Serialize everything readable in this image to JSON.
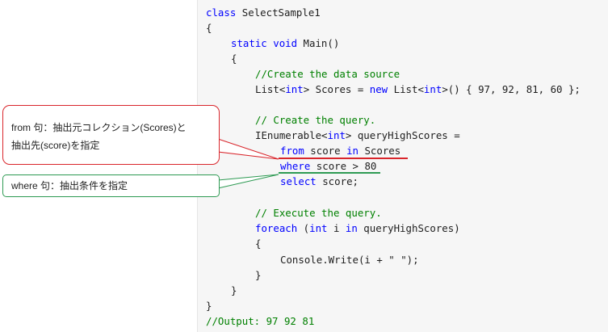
{
  "code": {
    "l01_class": "class",
    "l01_name": " SelectSample1",
    "l02": "{",
    "l03_static": "static",
    "l03_void": "void",
    "l03_main": " Main()",
    "l04": "{",
    "l05_comment": "//Create the data source",
    "l06_list": "List<",
    "l06_int": "int",
    "l06_mid": "> Scores = ",
    "l06_new": "new",
    "l06_list2": " List<",
    "l06_int2": "int",
    "l06_tail": ">() { 97, 92, 81, 60 };",
    "l08_comment": "// Create the query.",
    "l09_ienum": "IEnumerable<",
    "l09_int": "int",
    "l09_tail": "> queryHighScores =",
    "l10_from": "from",
    "l10_mid": " score ",
    "l10_in": "in",
    "l10_tail": " Scores",
    "l11_where": "where",
    "l11_tail": " score > 80",
    "l12_select": "select",
    "l12_tail": " score;",
    "l14_comment": "// Execute the query.",
    "l15_foreach": "foreach",
    "l15_open": " (",
    "l15_int": "int",
    "l15_mid": " i ",
    "l15_in": "in",
    "l15_tail": " queryHighScores)",
    "l16": "{",
    "l17_console": "Console.Write(i + \" \");",
    "l18": "}",
    "l19": "}",
    "l20": "}",
    "l21_comment": "//Output: 97 92 81"
  },
  "callouts": {
    "from_line1": "from 句：抽出元コレクション(Scores)と",
    "from_line2": "抽出先(score)を指定",
    "where_text": "where 句：抽出条件を指定"
  },
  "colors": {
    "keyword": "#0000ff",
    "type": "#2b91af",
    "comment": "#008000",
    "red_callout": "#d9252b",
    "green_callout": "#2e9a53"
  }
}
